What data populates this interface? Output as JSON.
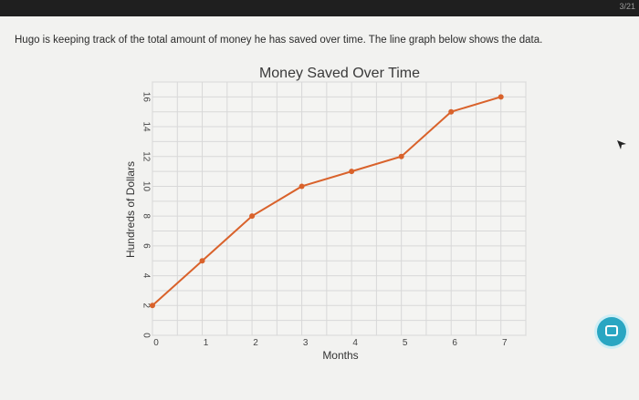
{
  "topbar": {
    "text": "3/21"
  },
  "question": {
    "text": "Hugo is keeping track of the total amount of money he has saved over time. The line graph below shows the data."
  },
  "chart_data": {
    "type": "line",
    "title": "Money Saved Over Time",
    "xlabel": "Months",
    "ylabel": "Hundreds of Dollars",
    "x": [
      0,
      1,
      2,
      3,
      4,
      5,
      6,
      7
    ],
    "y": [
      2,
      5,
      8,
      10,
      11,
      12,
      15,
      16
    ],
    "xlim": [
      0,
      7.5
    ],
    "ylim": [
      0,
      17
    ],
    "xticks": [
      "0",
      "1",
      "2",
      "3",
      "4",
      "5",
      "6",
      "7"
    ],
    "yticks": [
      "0",
      "2",
      "4",
      "6",
      "8",
      "10",
      "12",
      "14",
      "16"
    ],
    "grid": true,
    "line_color": "#d9622b"
  },
  "colors": {
    "accent": "#2aa6c2"
  }
}
